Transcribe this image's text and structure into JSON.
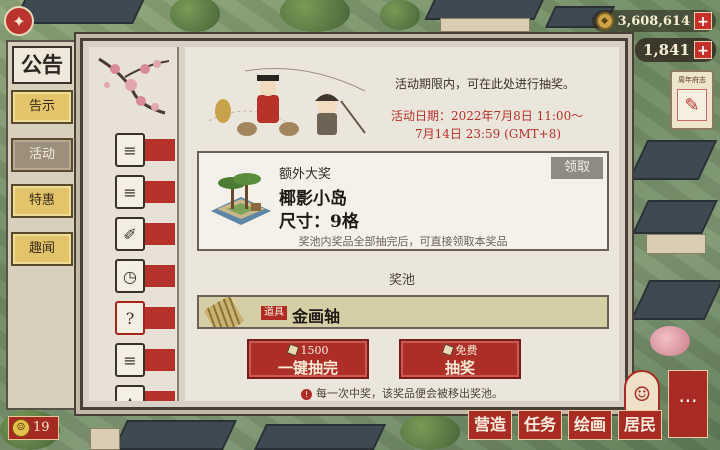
{
  "hud": {
    "settings_icon": "compass-flag-icon",
    "money": "3,608,614",
    "gems": "1,841",
    "plus": "+",
    "festival_card_title": "周年府志",
    "level": "19"
  },
  "tabs": {
    "title": "公告",
    "items": [
      {
        "label": "告示",
        "active": false
      },
      {
        "label": "活动",
        "active": true
      },
      {
        "label": "特惠",
        "active": false
      },
      {
        "label": "趣闻",
        "active": false
      }
    ]
  },
  "event": {
    "info": "活动期限内，可在此处进行抽奖。",
    "date_line1": "活动日期：2022年7月8日 11:00～",
    "date_line2": "7月14日 23:59 (GMT+8)"
  },
  "grand_prize": {
    "subtitle": "额外大奖",
    "name": "椰影小岛",
    "size": "尺寸：9格",
    "claim_label": "领取",
    "note": "奖池内奖品全部抽完后，可直接领取本奖品"
  },
  "pool": {
    "title": "奖池",
    "item_tag": "道具",
    "item_name": "金画轴"
  },
  "draw": {
    "all_cost": "1500",
    "all_label": "一键抽完",
    "single_cost": "免费",
    "single_label": "抽奖",
    "note": "每一次中奖，该奖品便会被移出奖池。"
  },
  "nav": {
    "build": "营造",
    "tasks": "任务",
    "paint": "绘画",
    "residents": "居民",
    "more": "···"
  }
}
